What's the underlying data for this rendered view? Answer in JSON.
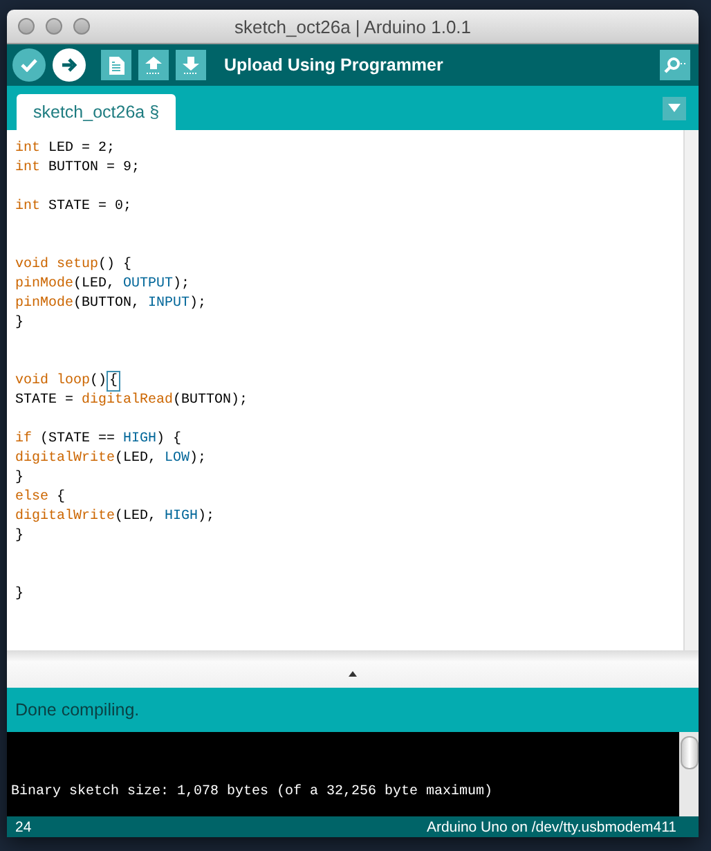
{
  "window": {
    "title": "sketch_oct26a | Arduino 1.0.1",
    "active": false
  },
  "toolbar": {
    "buttons": [
      {
        "kind": "verify",
        "highlighted": false
      },
      {
        "kind": "upload",
        "highlighted": true
      },
      {
        "kind": "new",
        "highlighted": false
      },
      {
        "kind": "open",
        "highlighted": false
      },
      {
        "kind": "save",
        "highlighted": false
      }
    ],
    "hover_label": "Upload Using Programmer"
  },
  "tabs": [
    {
      "label": "sketch_oct26a §",
      "selected": true
    }
  ],
  "editor": {
    "lines": [
      {
        "kind": "code",
        "segments": [
          {
            "text": "int",
            "kind": "keyword"
          },
          {
            "text": " LED = 2;",
            "kind": "plain"
          }
        ]
      },
      {
        "kind": "code",
        "segments": [
          {
            "text": "int",
            "kind": "keyword"
          },
          {
            "text": " BUTTON = 9;",
            "kind": "plain"
          }
        ]
      },
      {
        "kind": "blank"
      },
      {
        "kind": "code",
        "segments": [
          {
            "text": "int",
            "kind": "keyword"
          },
          {
            "text": " STATE = 0;",
            "kind": "plain"
          }
        ]
      },
      {
        "kind": "blank"
      },
      {
        "kind": "blank"
      },
      {
        "kind": "code",
        "segments": [
          {
            "text": "void ",
            "kind": "keyword"
          },
          {
            "text": "setup",
            "kind": "keyword"
          },
          {
            "text": "() {",
            "kind": "plain"
          }
        ]
      },
      {
        "kind": "code",
        "segments": [
          {
            "text": "pinMode",
            "kind": "keyword"
          },
          {
            "text": "(LED, ",
            "kind": "plain"
          },
          {
            "text": "OUTPUT",
            "kind": "constant"
          },
          {
            "text": ");",
            "kind": "plain"
          }
        ]
      },
      {
        "kind": "code",
        "segments": [
          {
            "text": "pinMode",
            "kind": "keyword"
          },
          {
            "text": "(BUTTON, ",
            "kind": "plain"
          },
          {
            "text": "INPUT",
            "kind": "constant"
          },
          {
            "text": ");",
            "kind": "plain"
          }
        ]
      },
      {
        "kind": "code",
        "segments": [
          {
            "text": "}",
            "kind": "plain"
          }
        ]
      },
      {
        "kind": "blank"
      },
      {
        "kind": "blank"
      },
      {
        "kind": "code",
        "segments": [
          {
            "text": "void ",
            "kind": "keyword"
          },
          {
            "text": "loop",
            "kind": "keyword"
          },
          {
            "text": "()",
            "kind": "plain"
          },
          {
            "text": "{",
            "kind": "matched"
          }
        ]
      },
      {
        "kind": "code",
        "segments": [
          {
            "text": "STATE = ",
            "kind": "plain"
          },
          {
            "text": "digitalRead",
            "kind": "keyword"
          },
          {
            "text": "(BUTTON);",
            "kind": "plain"
          }
        ]
      },
      {
        "kind": "blank"
      },
      {
        "kind": "code",
        "segments": [
          {
            "text": "if",
            "kind": "keyword"
          },
          {
            "text": " (STATE == ",
            "kind": "plain"
          },
          {
            "text": "HIGH",
            "kind": "constant"
          },
          {
            "text": ") {",
            "kind": "plain"
          }
        ]
      },
      {
        "kind": "code",
        "segments": [
          {
            "text": "digitalWrite",
            "kind": "keyword"
          },
          {
            "text": "(LED, ",
            "kind": "plain"
          },
          {
            "text": "LOW",
            "kind": "constant"
          },
          {
            "text": ");",
            "kind": "plain"
          }
        ]
      },
      {
        "kind": "code",
        "segments": [
          {
            "text": "}",
            "kind": "plain"
          }
        ]
      },
      {
        "kind": "code",
        "segments": [
          {
            "text": "else",
            "kind": "keyword"
          },
          {
            "text": " {",
            "kind": "plain"
          }
        ]
      },
      {
        "kind": "code",
        "segments": [
          {
            "text": "digitalWrite",
            "kind": "keyword"
          },
          {
            "text": "(LED, ",
            "kind": "plain"
          },
          {
            "text": "HIGH",
            "kind": "constant"
          },
          {
            "text": ");",
            "kind": "plain"
          }
        ]
      },
      {
        "kind": "code",
        "segments": [
          {
            "text": "}",
            "kind": "plain"
          }
        ]
      },
      {
        "kind": "blank"
      },
      {
        "kind": "blank"
      },
      {
        "kind": "code",
        "segments": [
          {
            "text": "}",
            "kind": "plain"
          }
        ]
      }
    ]
  },
  "status_message": "Done compiling.",
  "console": {
    "lines": [
      "Binary sketch size: 1,078 bytes (of a 32,256 byte maximum)"
    ]
  },
  "status_bar": {
    "line_number": "24",
    "board": "Arduino Uno on /dev/tty.usbmodem411"
  }
}
